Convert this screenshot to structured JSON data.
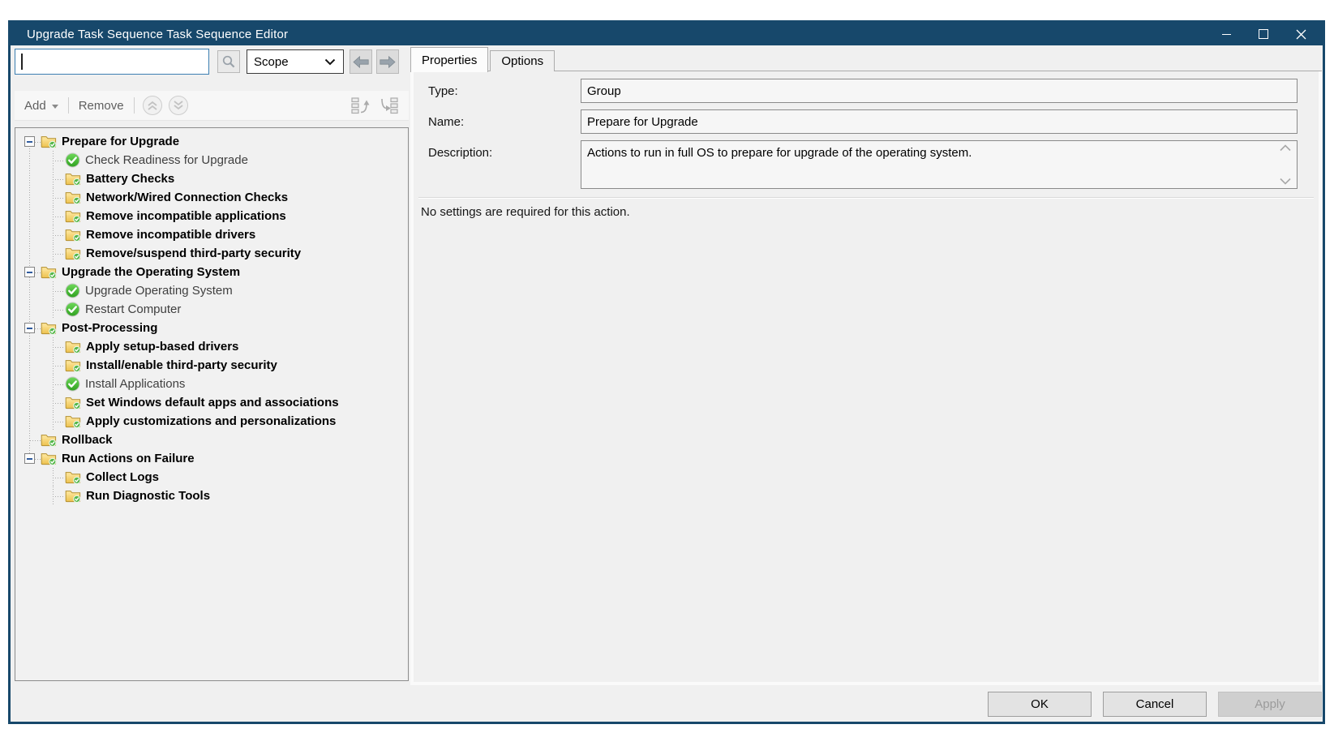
{
  "window": {
    "title": "Upgrade Task Sequence Task Sequence Editor"
  },
  "search": {
    "value": "",
    "placeholder": "",
    "scope_value": "Scope"
  },
  "toolbar": {
    "add_label": "Add",
    "remove_label": "Remove"
  },
  "icons": {
    "search": "magnifier-icon",
    "scope_dropdown": "chevron-down-icon",
    "back": "arrow-left-icon",
    "forward": "arrow-right-icon",
    "move_up": "double-chevron-up-icon",
    "move_down": "double-chevron-down-icon",
    "move_step_out": "list-curved-arrow-up-icon",
    "move_step_in": "list-curved-arrow-down-icon",
    "group": "folder-with-green-check-icon",
    "step_success": "green-circle-check-icon",
    "minimize": "minimize-icon",
    "maximize": "maximize-icon",
    "close": "close-icon"
  },
  "tree": {
    "items": [
      {
        "label": "Prepare for Upgrade",
        "depth": 0,
        "icon": "folder",
        "bold": true,
        "expander": true
      },
      {
        "label": "Check Readiness for Upgrade",
        "depth": 1,
        "icon": "check",
        "bold": false,
        "expander": false
      },
      {
        "label": "Battery Checks",
        "depth": 1,
        "icon": "folder",
        "bold": true,
        "expander": false
      },
      {
        "label": "Network/Wired Connection Checks",
        "depth": 1,
        "icon": "folder",
        "bold": true,
        "expander": false
      },
      {
        "label": "Remove incompatible applications",
        "depth": 1,
        "icon": "folder",
        "bold": true,
        "expander": false
      },
      {
        "label": "Remove incompatible drivers",
        "depth": 1,
        "icon": "folder",
        "bold": true,
        "expander": false
      },
      {
        "label": "Remove/suspend third-party security",
        "depth": 1,
        "icon": "folder",
        "bold": true,
        "expander": false
      },
      {
        "label": "Upgrade the Operating System",
        "depth": 0,
        "icon": "folder",
        "bold": true,
        "expander": true
      },
      {
        "label": "Upgrade Operating System",
        "depth": 1,
        "icon": "check",
        "bold": false,
        "expander": false
      },
      {
        "label": "Restart Computer",
        "depth": 1,
        "icon": "check",
        "bold": false,
        "expander": false
      },
      {
        "label": "Post-Processing",
        "depth": 0,
        "icon": "folder",
        "bold": true,
        "expander": true
      },
      {
        "label": "Apply setup-based drivers",
        "depth": 1,
        "icon": "folder",
        "bold": true,
        "expander": false
      },
      {
        "label": "Install/enable third-party security",
        "depth": 1,
        "icon": "folder",
        "bold": true,
        "expander": false
      },
      {
        "label": "Install Applications",
        "depth": 1,
        "icon": "check",
        "bold": false,
        "expander": false
      },
      {
        "label": "Set Windows default apps and associations",
        "depth": 1,
        "icon": "folder",
        "bold": true,
        "expander": false
      },
      {
        "label": "Apply customizations and personalizations",
        "depth": 1,
        "icon": "folder",
        "bold": true,
        "expander": false
      },
      {
        "label": "Rollback",
        "depth": 0,
        "icon": "folder",
        "bold": true,
        "expander": false
      },
      {
        "label": "Run Actions on Failure",
        "depth": 0,
        "icon": "folder",
        "bold": true,
        "expander": true
      },
      {
        "label": "Collect Logs",
        "depth": 1,
        "icon": "folder",
        "bold": true,
        "expander": false
      },
      {
        "label": "Run Diagnostic Tools",
        "depth": 1,
        "icon": "folder",
        "bold": true,
        "expander": false
      }
    ]
  },
  "tabs": [
    {
      "label": "Properties",
      "active": true
    },
    {
      "label": "Options",
      "active": false
    }
  ],
  "properties": {
    "type_label": "Type:",
    "type_value": "Group",
    "name_label": "Name:",
    "name_value": "Prepare for Upgrade",
    "description_label": "Description:",
    "description_value": "Actions to run in full OS to prepare for upgrade of the operating system.",
    "note": "No settings are required for this action."
  },
  "footer": {
    "ok_label": "OK",
    "cancel_label": "Cancel",
    "apply_label": "Apply"
  },
  "colors": {
    "titlebar": "#17486B",
    "focus_border": "#3C7FB1",
    "panel_bg": "#F0F0F0",
    "folder_yellow": "#F2C94C",
    "check_green": "#3FAE2F"
  }
}
